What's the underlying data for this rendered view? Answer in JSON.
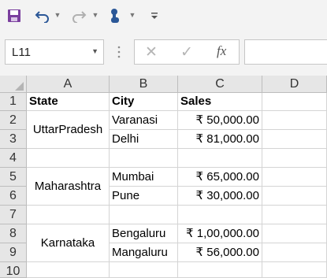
{
  "toolbar": {
    "icons": [
      "save-icon",
      "undo-icon",
      "redo-icon",
      "touch-mode-icon",
      "customize-qat-icon"
    ]
  },
  "formula_bar": {
    "name_box": "L11",
    "cancel_symbol": "✕",
    "enter_symbol": "✓",
    "fx_symbol": "fx",
    "formula_value": ""
  },
  "sheet": {
    "columns": [
      "A",
      "B",
      "C",
      "D"
    ],
    "rows": [
      "1",
      "2",
      "3",
      "4",
      "5",
      "6",
      "7",
      "8",
      "9",
      "10"
    ],
    "headers": {
      "state": "State",
      "city": "City",
      "sales": "Sales"
    },
    "groups": [
      {
        "state": "UttarPradesh",
        "cities": [
          {
            "city": "Varanasi",
            "sales": "₹ 50,000.00"
          },
          {
            "city": "Delhi",
            "sales": "₹ 81,000.00"
          }
        ]
      },
      {
        "state": "Maharashtra",
        "cities": [
          {
            "city": "Mumbai",
            "sales": "₹ 65,000.00"
          },
          {
            "city": "Pune",
            "sales": "₹ 30,000.00"
          }
        ]
      },
      {
        "state": "Karnataka",
        "cities": [
          {
            "city": "Bengaluru",
            "sales": "₹ 1,00,000.00"
          },
          {
            "city": "Mangaluru",
            "sales": "₹ 56,000.00"
          }
        ]
      }
    ]
  }
}
